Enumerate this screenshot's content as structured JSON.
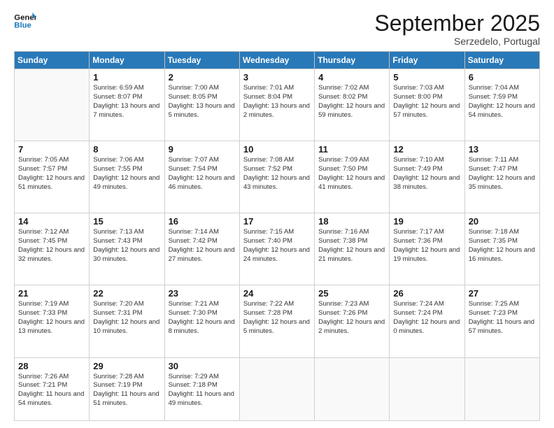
{
  "logo": {
    "line1": "General",
    "line2": "Blue"
  },
  "title": "September 2025",
  "location": "Serzedelo, Portugal",
  "weekdays": [
    "Sunday",
    "Monday",
    "Tuesday",
    "Wednesday",
    "Thursday",
    "Friday",
    "Saturday"
  ],
  "weeks": [
    [
      {
        "day": "",
        "info": ""
      },
      {
        "day": "1",
        "info": "Sunrise: 6:59 AM\nSunset: 8:07 PM\nDaylight: 13 hours\nand 7 minutes."
      },
      {
        "day": "2",
        "info": "Sunrise: 7:00 AM\nSunset: 8:05 PM\nDaylight: 13 hours\nand 5 minutes."
      },
      {
        "day": "3",
        "info": "Sunrise: 7:01 AM\nSunset: 8:04 PM\nDaylight: 13 hours\nand 2 minutes."
      },
      {
        "day": "4",
        "info": "Sunrise: 7:02 AM\nSunset: 8:02 PM\nDaylight: 12 hours\nand 59 minutes."
      },
      {
        "day": "5",
        "info": "Sunrise: 7:03 AM\nSunset: 8:00 PM\nDaylight: 12 hours\nand 57 minutes."
      },
      {
        "day": "6",
        "info": "Sunrise: 7:04 AM\nSunset: 7:59 PM\nDaylight: 12 hours\nand 54 minutes."
      }
    ],
    [
      {
        "day": "7",
        "info": "Sunrise: 7:05 AM\nSunset: 7:57 PM\nDaylight: 12 hours\nand 51 minutes."
      },
      {
        "day": "8",
        "info": "Sunrise: 7:06 AM\nSunset: 7:55 PM\nDaylight: 12 hours\nand 49 minutes."
      },
      {
        "day": "9",
        "info": "Sunrise: 7:07 AM\nSunset: 7:54 PM\nDaylight: 12 hours\nand 46 minutes."
      },
      {
        "day": "10",
        "info": "Sunrise: 7:08 AM\nSunset: 7:52 PM\nDaylight: 12 hours\nand 43 minutes."
      },
      {
        "day": "11",
        "info": "Sunrise: 7:09 AM\nSunset: 7:50 PM\nDaylight: 12 hours\nand 41 minutes."
      },
      {
        "day": "12",
        "info": "Sunrise: 7:10 AM\nSunset: 7:49 PM\nDaylight: 12 hours\nand 38 minutes."
      },
      {
        "day": "13",
        "info": "Sunrise: 7:11 AM\nSunset: 7:47 PM\nDaylight: 12 hours\nand 35 minutes."
      }
    ],
    [
      {
        "day": "14",
        "info": "Sunrise: 7:12 AM\nSunset: 7:45 PM\nDaylight: 12 hours\nand 32 minutes."
      },
      {
        "day": "15",
        "info": "Sunrise: 7:13 AM\nSunset: 7:43 PM\nDaylight: 12 hours\nand 30 minutes."
      },
      {
        "day": "16",
        "info": "Sunrise: 7:14 AM\nSunset: 7:42 PM\nDaylight: 12 hours\nand 27 minutes."
      },
      {
        "day": "17",
        "info": "Sunrise: 7:15 AM\nSunset: 7:40 PM\nDaylight: 12 hours\nand 24 minutes."
      },
      {
        "day": "18",
        "info": "Sunrise: 7:16 AM\nSunset: 7:38 PM\nDaylight: 12 hours\nand 21 minutes."
      },
      {
        "day": "19",
        "info": "Sunrise: 7:17 AM\nSunset: 7:36 PM\nDaylight: 12 hours\nand 19 minutes."
      },
      {
        "day": "20",
        "info": "Sunrise: 7:18 AM\nSunset: 7:35 PM\nDaylight: 12 hours\nand 16 minutes."
      }
    ],
    [
      {
        "day": "21",
        "info": "Sunrise: 7:19 AM\nSunset: 7:33 PM\nDaylight: 12 hours\nand 13 minutes."
      },
      {
        "day": "22",
        "info": "Sunrise: 7:20 AM\nSunset: 7:31 PM\nDaylight: 12 hours\nand 10 minutes."
      },
      {
        "day": "23",
        "info": "Sunrise: 7:21 AM\nSunset: 7:30 PM\nDaylight: 12 hours\nand 8 minutes."
      },
      {
        "day": "24",
        "info": "Sunrise: 7:22 AM\nSunset: 7:28 PM\nDaylight: 12 hours\nand 5 minutes."
      },
      {
        "day": "25",
        "info": "Sunrise: 7:23 AM\nSunset: 7:26 PM\nDaylight: 12 hours\nand 2 minutes."
      },
      {
        "day": "26",
        "info": "Sunrise: 7:24 AM\nSunset: 7:24 PM\nDaylight: 12 hours\nand 0 minutes."
      },
      {
        "day": "27",
        "info": "Sunrise: 7:25 AM\nSunset: 7:23 PM\nDaylight: 11 hours\nand 57 minutes."
      }
    ],
    [
      {
        "day": "28",
        "info": "Sunrise: 7:26 AM\nSunset: 7:21 PM\nDaylight: 11 hours\nand 54 minutes."
      },
      {
        "day": "29",
        "info": "Sunrise: 7:28 AM\nSunset: 7:19 PM\nDaylight: 11 hours\nand 51 minutes."
      },
      {
        "day": "30",
        "info": "Sunrise: 7:29 AM\nSunset: 7:18 PM\nDaylight: 11 hours\nand 49 minutes."
      },
      {
        "day": "",
        "info": ""
      },
      {
        "day": "",
        "info": ""
      },
      {
        "day": "",
        "info": ""
      },
      {
        "day": "",
        "info": ""
      }
    ]
  ]
}
